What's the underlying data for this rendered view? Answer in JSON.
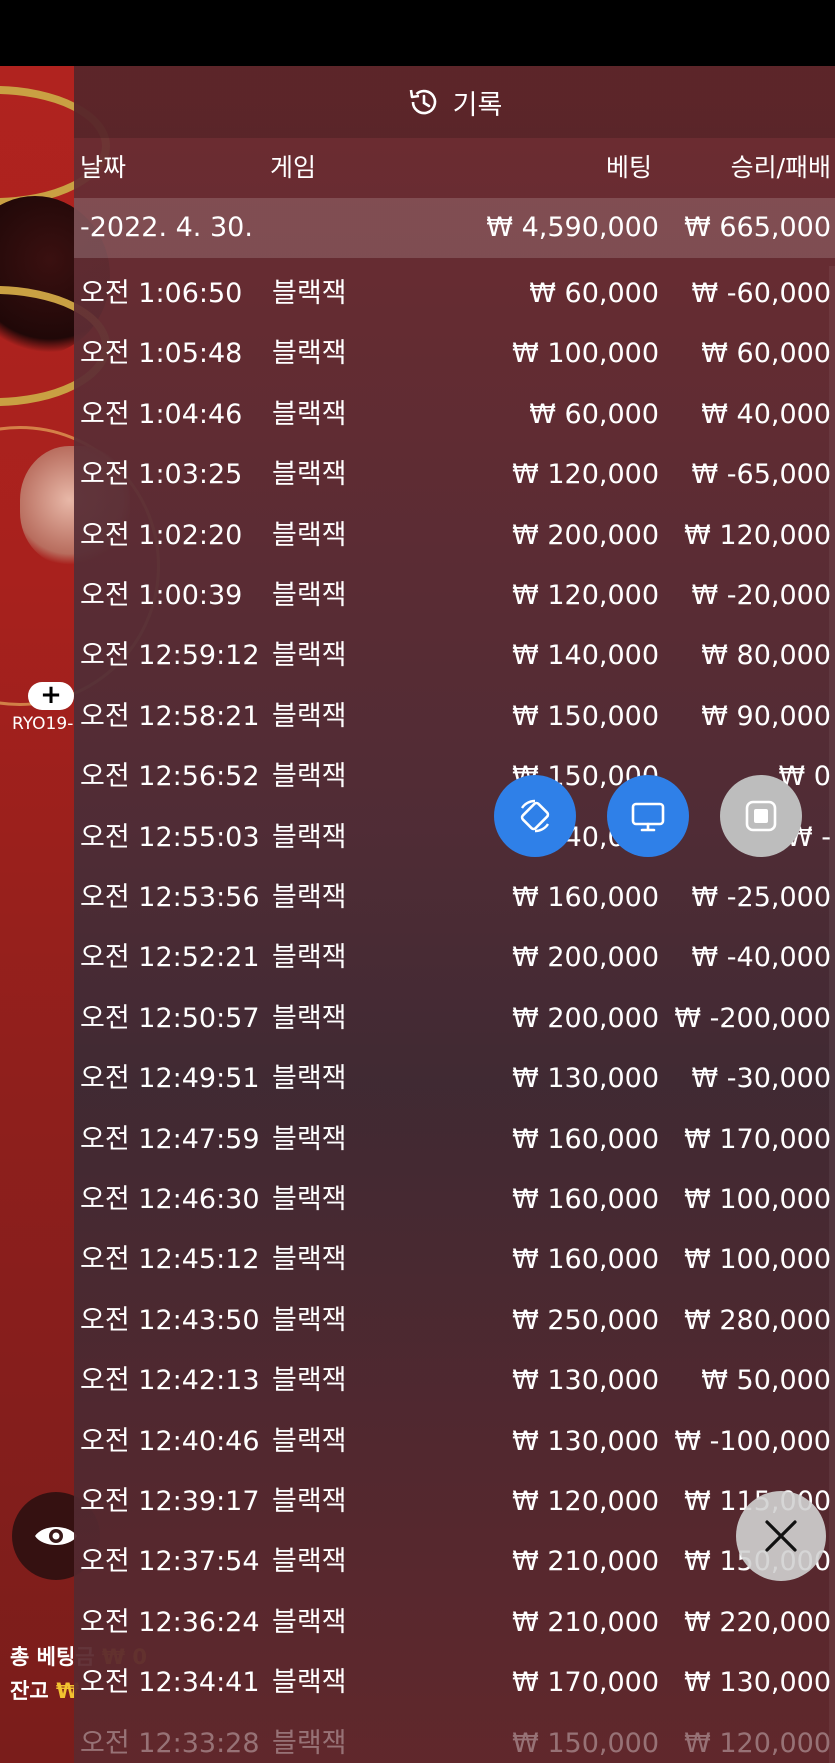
{
  "panel": {
    "title": "기록",
    "columns": {
      "date": "날짜",
      "game": "게임",
      "bet": "베팅",
      "result": "승리/패배"
    },
    "summary": {
      "date": "-2022. 4. 30.",
      "bet": "₩ 4,590,000",
      "result": "₩ 665,000"
    },
    "rows": [
      {
        "time": "오전 1:06:50",
        "game": "블랙잭",
        "bet": "₩ 60,000",
        "result": "₩ -60,000"
      },
      {
        "time": "오전 1:05:48",
        "game": "블랙잭",
        "bet": "₩ 100,000",
        "result": "₩ 60,000"
      },
      {
        "time": "오전 1:04:46",
        "game": "블랙잭",
        "bet": "₩ 60,000",
        "result": "₩ 40,000"
      },
      {
        "time": "오전 1:03:25",
        "game": "블랙잭",
        "bet": "₩ 120,000",
        "result": "₩ -65,000"
      },
      {
        "time": "오전 1:02:20",
        "game": "블랙잭",
        "bet": "₩ 200,000",
        "result": "₩ 120,000"
      },
      {
        "time": "오전 1:00:39",
        "game": "블랙잭",
        "bet": "₩ 120,000",
        "result": "₩ -20,000"
      },
      {
        "time": "오전 12:59:12",
        "game": "블랙잭",
        "bet": "₩ 140,000",
        "result": "₩ 80,000"
      },
      {
        "time": "오전 12:58:21",
        "game": "블랙잭",
        "bet": "₩ 150,000",
        "result": "₩ 90,000"
      },
      {
        "time": "오전 12:56:52",
        "game": "블랙잭",
        "bet": "₩ 150,000",
        "result": "₩ 0"
      },
      {
        "time": "오전 12:55:03",
        "game": "블랙잭",
        "bet": "₩ 140,000",
        "result": "₩ -"
      },
      {
        "time": "오전 12:53:56",
        "game": "블랙잭",
        "bet": "₩ 160,000",
        "result": "₩ -25,000"
      },
      {
        "time": "오전 12:52:21",
        "game": "블랙잭",
        "bet": "₩ 200,000",
        "result": "₩ -40,000"
      },
      {
        "time": "오전 12:50:57",
        "game": "블랙잭",
        "bet": "₩ 200,000",
        "result": "₩ -200,000"
      },
      {
        "time": "오전 12:49:51",
        "game": "블랙잭",
        "bet": "₩ 130,000",
        "result": "₩ -30,000"
      },
      {
        "time": "오전 12:47:59",
        "game": "블랙잭",
        "bet": "₩ 160,000",
        "result": "₩ 170,000"
      },
      {
        "time": "오전 12:46:30",
        "game": "블랙잭",
        "bet": "₩ 160,000",
        "result": "₩ 100,000"
      },
      {
        "time": "오전 12:45:12",
        "game": "블랙잭",
        "bet": "₩ 160,000",
        "result": "₩ 100,000"
      },
      {
        "time": "오전 12:43:50",
        "game": "블랙잭",
        "bet": "₩ 250,000",
        "result": "₩ 280,000"
      },
      {
        "time": "오전 12:42:13",
        "game": "블랙잭",
        "bet": "₩ 130,000",
        "result": "₩ 50,000"
      },
      {
        "time": "오전 12:40:46",
        "game": "블랙잭",
        "bet": "₩ 130,000",
        "result": "₩ -100,000"
      },
      {
        "time": "오전 12:39:17",
        "game": "블랙잭",
        "bet": "₩ 120,000",
        "result": "₩ 115,000"
      },
      {
        "time": "오전 12:37:54",
        "game": "블랙잭",
        "bet": "₩ 210,000",
        "result": "₩ 150,000"
      },
      {
        "time": "오전 12:36:24",
        "game": "블랙잭",
        "bet": "₩ 210,000",
        "result": "₩ 220,000"
      },
      {
        "time": "오전 12:34:41",
        "game": "블랙잭",
        "bet": "₩ 170,000",
        "result": "₩ 130,000"
      },
      {
        "time": "오전 12:33:28",
        "game": "블랙잭",
        "bet": "₩ 150,000",
        "result": "₩ 120,000"
      }
    ]
  },
  "player": {
    "add_symbol": "+",
    "name": "RYO19-"
  },
  "footer": {
    "total_bet_label": "총 베팅금",
    "total_bet_value": "₩ 0",
    "balance_label": "잔고",
    "balance_value": "₩"
  },
  "icons": {
    "history": "history-icon",
    "rotate": "rotate-icon",
    "monitor": "monitor-icon",
    "stop": "stop-icon",
    "eye": "eye-icon",
    "close": "close-icon"
  },
  "colors": {
    "fab_blue": "#2f80e8",
    "fab_grey": "#bdbdbd",
    "balance_accent": "#f2c230"
  }
}
